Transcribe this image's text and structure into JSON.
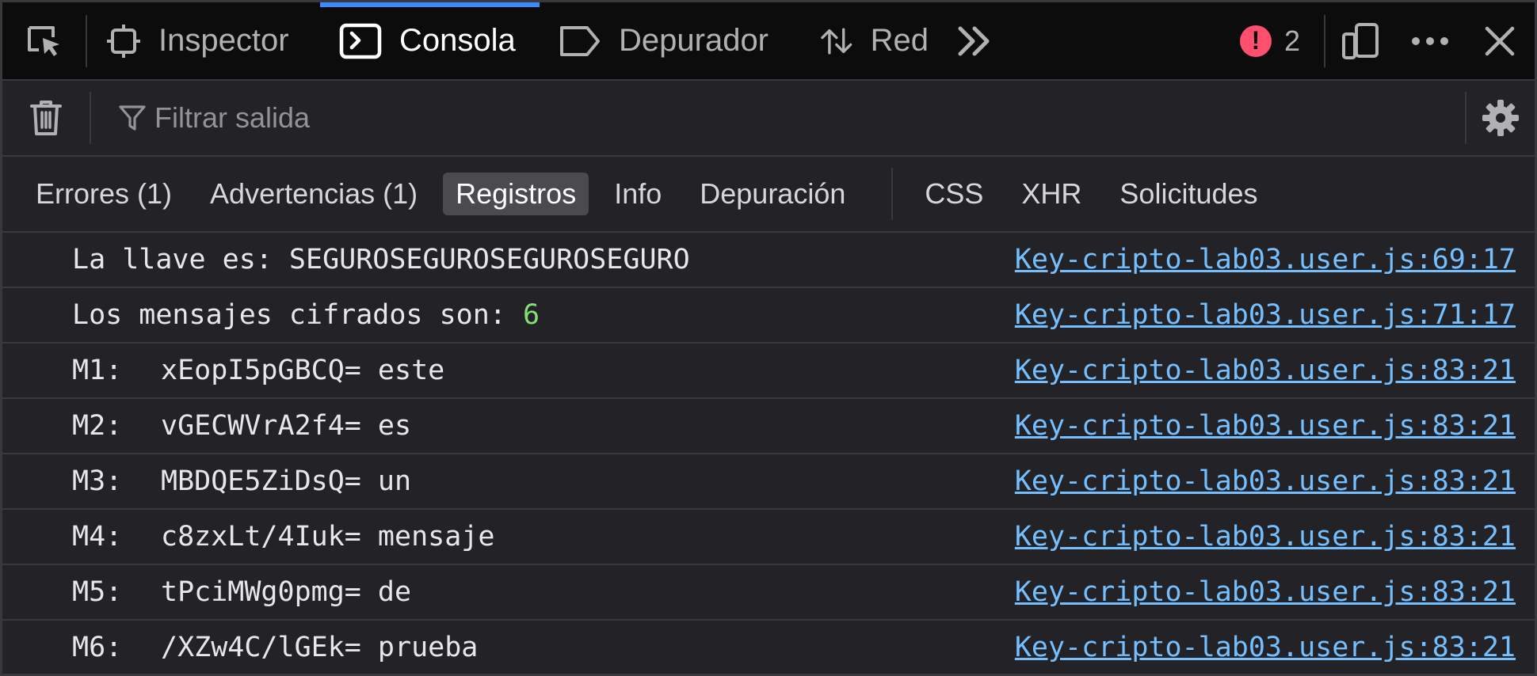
{
  "toolbar": {
    "tabs": [
      {
        "label": "Inspector"
      },
      {
        "label": "Consola"
      },
      {
        "label": "Depurador"
      },
      {
        "label": "Red"
      }
    ],
    "error_count": "2",
    "error_color": "#ff4f6e",
    "selected_tab_accent": "#3a8bff"
  },
  "filter": {
    "placeholder": "Filtrar salida"
  },
  "categories": {
    "errors": "Errores (1)",
    "warnings": "Advertencias (1)",
    "logs": "Registros",
    "info": "Info",
    "debug": "Depuración",
    "css": "CSS",
    "xhr": "XHR",
    "requests": "Solicitudes"
  },
  "log": {
    "rows": [
      {
        "text": "La llave es: SEGUROSEGUROSEGUROSEGURO",
        "source": "Key-cripto-lab03.user.js:69:17"
      },
      {
        "text": "Los mensajes cifrados son: ",
        "number": "6",
        "source": "Key-cripto-lab03.user.js:71:17"
      },
      {
        "label": "M1:",
        "text": "xEopI5pGBCQ= este",
        "source": "Key-cripto-lab03.user.js:83:21"
      },
      {
        "label": "M2:",
        "text": "vGECWVrA2f4= es",
        "source": "Key-cripto-lab03.user.js:83:21"
      },
      {
        "label": "M3:",
        "text": "MBDQE5ZiDsQ= un",
        "source": "Key-cripto-lab03.user.js:83:21"
      },
      {
        "label": "M4:",
        "text": "c8zxLt/4Iuk= mensaje",
        "source": "Key-cripto-lab03.user.js:83:21"
      },
      {
        "label": "M5:",
        "text": "tPciMWg0pmg= de",
        "source": "Key-cripto-lab03.user.js:83:21"
      },
      {
        "label": "M6:",
        "text": "/XZw4C/lGEk= prueba",
        "source": "Key-cripto-lab03.user.js:83:21"
      }
    ],
    "link_color": "#75bfff",
    "number_color": "#86de74"
  }
}
